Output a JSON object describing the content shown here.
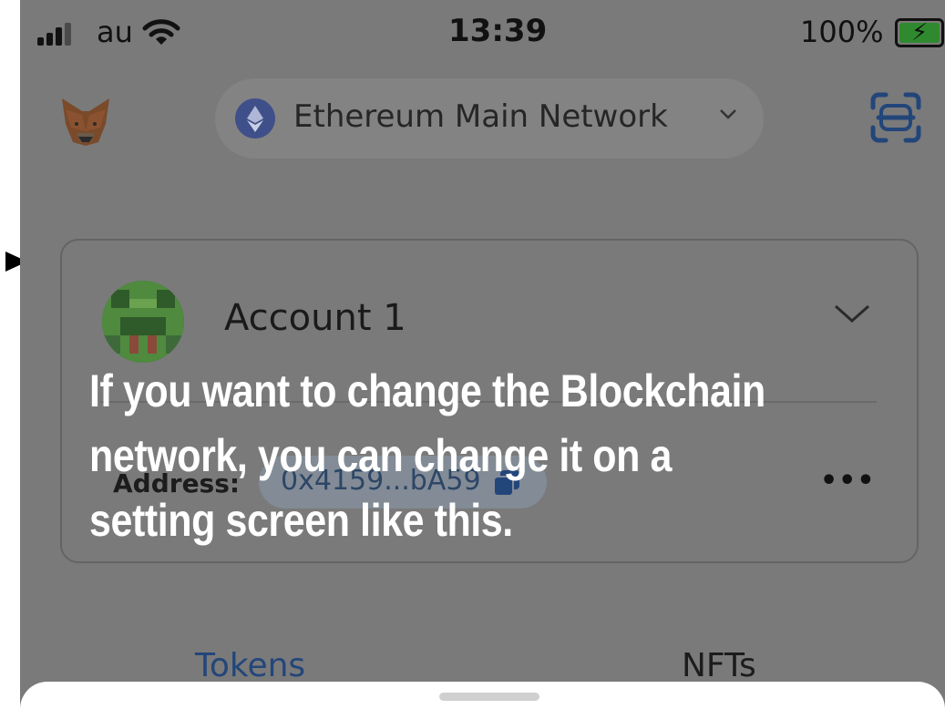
{
  "status_bar": {
    "carrier": "au",
    "time": "13:39",
    "battery": "100%"
  },
  "header": {
    "network": "Ethereum Main Network"
  },
  "account": {
    "name": "Account 1",
    "address_label": "Address:",
    "address": "0x4159...bA59",
    "more": "•••"
  },
  "tabs": [
    {
      "label": "Tokens",
      "active": true
    },
    {
      "label": "NFTs",
      "active": false
    }
  ],
  "caption": "If you want to change the Blockchain network, you can change it on a setting screen like this.",
  "colors": {
    "overlay": "#7a7a7a",
    "active_tab": "#23467a",
    "caption": "#ffffff"
  },
  "icons": [
    "signal-icon",
    "wifi-icon",
    "battery-icon",
    "metamask-fox-icon",
    "ethereum-icon",
    "chevron-down-icon",
    "scan-qr-icon",
    "copy-icon",
    "pointer-arrow-icon"
  ]
}
